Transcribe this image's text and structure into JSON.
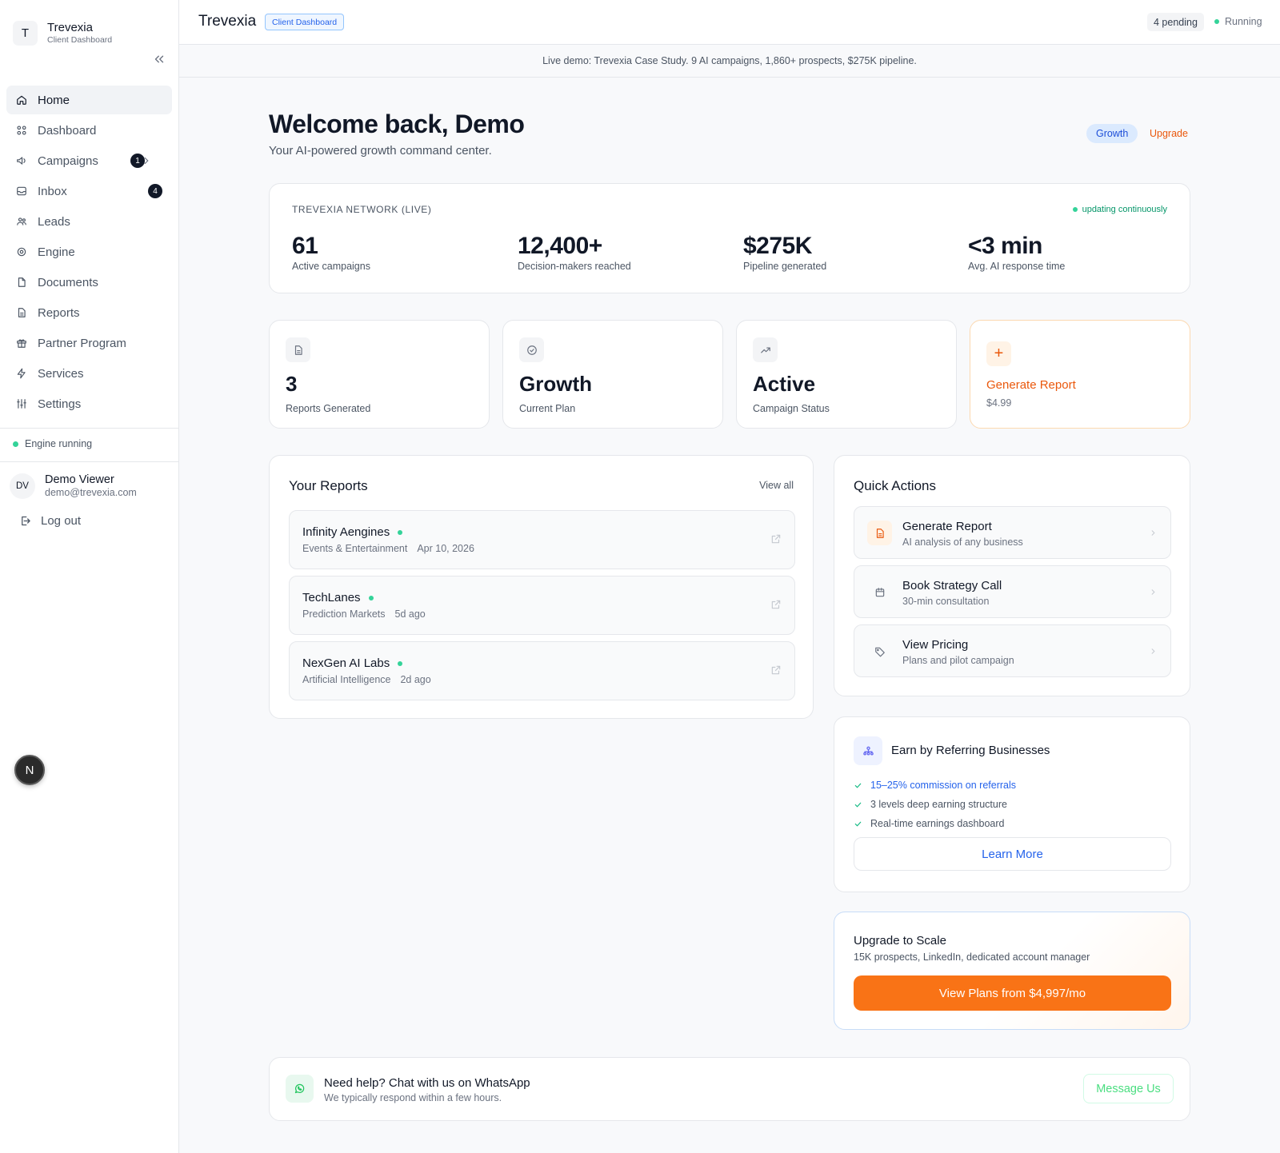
{
  "app": {
    "name": "Trevexia",
    "subtitle": "Client Dashboard",
    "logo_letter": "T"
  },
  "sidebar": {
    "items": [
      {
        "label": "Home",
        "icon": "home-icon",
        "active": true
      },
      {
        "label": "Dashboard",
        "icon": "grid-icon"
      },
      {
        "label": "Campaigns",
        "icon": "megaphone-icon",
        "badge": "1"
      },
      {
        "label": "Inbox",
        "icon": "inbox-icon",
        "badge": "4"
      },
      {
        "label": "Leads",
        "icon": "users-icon"
      },
      {
        "label": "Engine",
        "icon": "cog-icon"
      },
      {
        "label": "Documents",
        "icon": "file-icon"
      },
      {
        "label": "Reports",
        "icon": "report-icon"
      },
      {
        "label": "Partner Program",
        "icon": "gift-icon"
      },
      {
        "label": "Services",
        "icon": "bolt-icon"
      },
      {
        "label": "Settings",
        "icon": "sliders-icon"
      }
    ],
    "engine_status": "Engine running",
    "user": {
      "initials": "DV",
      "name": "Demo Viewer",
      "email": "demo@trevexia.com"
    },
    "logout": "Log out",
    "floating_badge": "N"
  },
  "topbar": {
    "title": "Trevexia",
    "pill": "Client Dashboard",
    "pending": "4 pending",
    "status": "Running"
  },
  "banner": "Live demo: Trevexia Case Study. 9 AI campaigns, 1,860+ prospects, $275K pipeline.",
  "welcome": {
    "title": "Welcome back, Demo",
    "subtitle": "Your AI-powered growth command center.",
    "plan": "Growth",
    "upgrade": "Upgrade"
  },
  "network": {
    "label": "TREVEXIA NETWORK (LIVE)",
    "updating": "updating continuously",
    "stats": [
      {
        "value": "61",
        "desc": "Active campaigns"
      },
      {
        "value": "12,400+",
        "desc": "Decision-makers reached"
      },
      {
        "value": "$275K",
        "desc": "Pipeline generated"
      },
      {
        "value": "<3 min",
        "desc": "Avg. AI response time"
      }
    ]
  },
  "stat_cards": [
    {
      "value": "3",
      "desc": "Reports Generated",
      "icon": "document-icon"
    },
    {
      "value": "Growth",
      "desc": "Current Plan",
      "icon": "check-circle-icon"
    },
    {
      "value": "Active",
      "desc": "Campaign Status",
      "icon": "trending-up-icon"
    }
  ],
  "generate_card": {
    "title": "Generate Report",
    "price": "$4.99",
    "icon": "plus-icon"
  },
  "reports": {
    "title": "Your Reports",
    "view_all": "View all",
    "items": [
      {
        "name": "Infinity Aengines",
        "category": "Events & Entertainment",
        "date": "Apr 10, 2026"
      },
      {
        "name": "TechLanes",
        "category": "Prediction Markets",
        "date": "5d ago"
      },
      {
        "name": "NexGen AI Labs",
        "category": "Artificial Intelligence",
        "date": "2d ago"
      }
    ]
  },
  "quick_actions": {
    "title": "Quick Actions",
    "items": [
      {
        "title": "Generate Report",
        "sub": "AI analysis of any business",
        "icon": "document-icon"
      },
      {
        "title": "Book Strategy Call",
        "sub": "30-min consultation",
        "icon": "calendar-icon"
      },
      {
        "title": "View Pricing",
        "sub": "Plans and pilot campaign",
        "icon": "tag-icon"
      }
    ]
  },
  "referral": {
    "title": "Earn by Referring Businesses",
    "items": [
      "15–25% commission on referrals",
      "3 levels deep earning structure",
      "Real-time earnings dashboard"
    ],
    "button": "Learn More"
  },
  "scale": {
    "title": "Upgrade to Scale",
    "sub": "15K prospects, LinkedIn, dedicated account manager",
    "button": "View Plans from $4,997/mo"
  },
  "help": {
    "title": "Need help? Chat with us on WhatsApp",
    "sub": "We typically respond within a few hours.",
    "button": "Message Us"
  },
  "colors": {
    "accent": "#f97316",
    "brand_blue": "#2563eb",
    "status_green": "#34d399"
  }
}
